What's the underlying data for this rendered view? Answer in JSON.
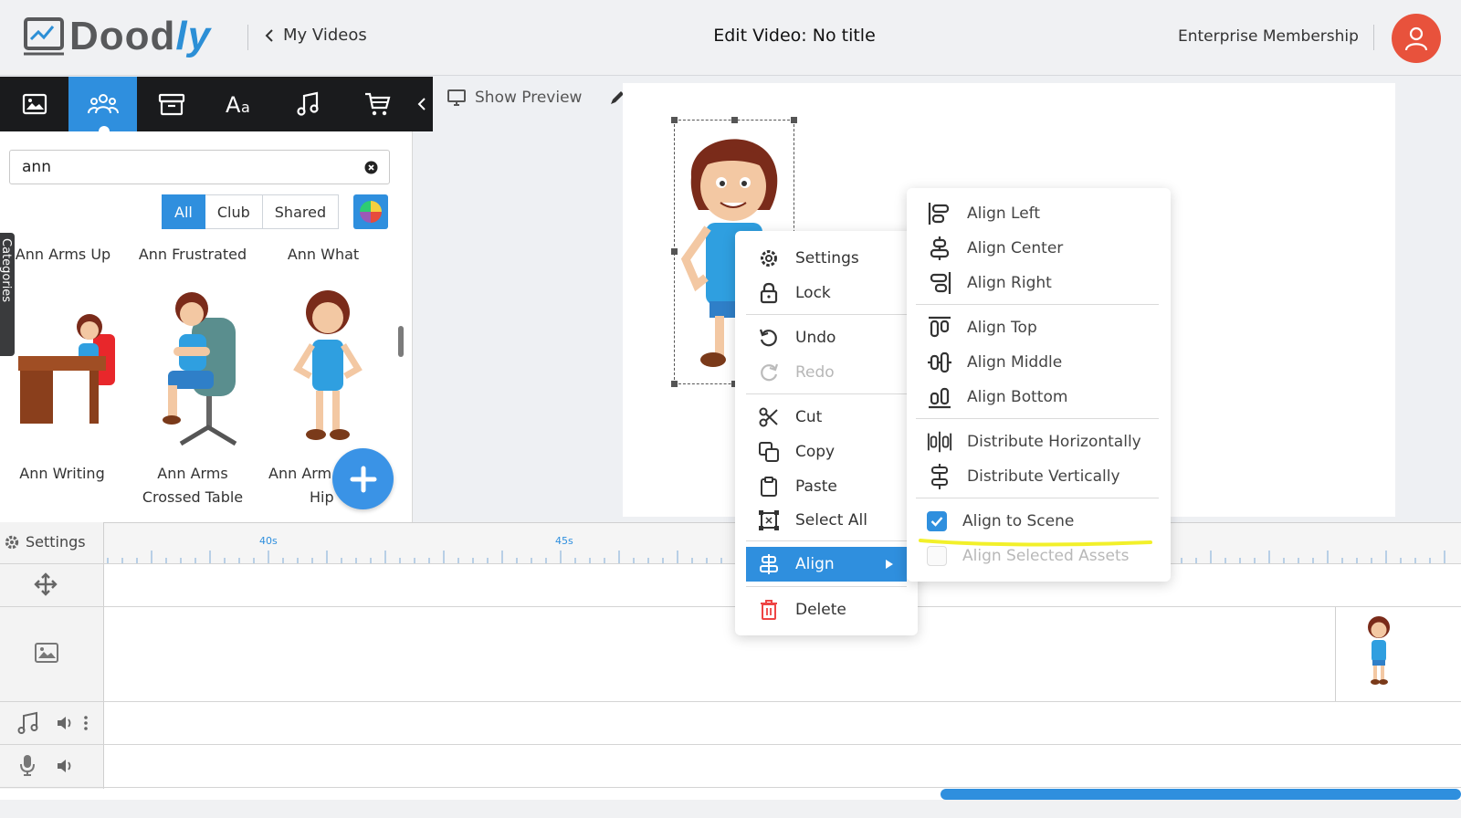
{
  "app": {
    "logo_text_main": "Dood",
    "logo_text_accent": "ly",
    "back_label": "My Videos",
    "title": "Edit Video: No title",
    "membership": "Enterprise Membership"
  },
  "colors": {
    "accent": "#2f8fde",
    "tabbar_bg": "#1a1b1d",
    "avatar_bg": "#e8523c",
    "delete_icon": "#e44",
    "highlighter": "#f2f02a"
  },
  "library": {
    "tabs": [
      {
        "name": "image-icon",
        "active": false
      },
      {
        "name": "characters-icon",
        "active": true
      },
      {
        "name": "props-icon",
        "active": false
      },
      {
        "name": "text-icon",
        "active": false
      },
      {
        "name": "music-icon",
        "active": false
      },
      {
        "name": "cart-icon",
        "active": false
      }
    ],
    "search_value": "ann",
    "filters": [
      "All",
      "Club",
      "Shared"
    ],
    "active_filter": "All",
    "categories_label": "Categories",
    "assets_row1": [
      "Ann Arms Up",
      "Ann Frustrated",
      "Ann What"
    ],
    "assets_row2": [
      {
        "line1": "Ann Writing",
        "line2": ""
      },
      {
        "line1": "Ann Arms",
        "line2": "Crossed Table"
      },
      {
        "line1": "Ann Arm",
        "line2": "Hip"
      }
    ]
  },
  "canvas": {
    "preview_label": "Show Preview",
    "tools": [
      "pencil-icon",
      "gear-icon",
      "flip-icon",
      "bring-forward-icon",
      "send-backward-icon",
      "trash-icon"
    ]
  },
  "context_menu": {
    "items": [
      {
        "label": "Settings",
        "icon": "gear-icon"
      },
      {
        "label": "Lock",
        "icon": "lock-icon"
      },
      {
        "label": "Undo",
        "icon": "undo-icon"
      },
      {
        "label": "Redo",
        "icon": "redo-icon",
        "disabled": true
      },
      {
        "label": "Cut",
        "icon": "scissors-icon"
      },
      {
        "label": "Copy",
        "icon": "copy-icon"
      },
      {
        "label": "Paste",
        "icon": "clipboard-icon"
      },
      {
        "label": "Select All",
        "icon": "select-all-icon"
      },
      {
        "label": "Align",
        "icon": "align-icon",
        "highlighted": true
      },
      {
        "label": "Delete",
        "icon": "trash-icon"
      }
    ]
  },
  "align_menu": {
    "items": [
      {
        "label": "Align Left",
        "icon": "align-left-icon"
      },
      {
        "label": "Align Center",
        "icon": "align-center-icon"
      },
      {
        "label": "Align Right",
        "icon": "align-right-icon"
      },
      {
        "label": "Align Top",
        "icon": "align-top-icon"
      },
      {
        "label": "Align Middle",
        "icon": "align-middle-icon"
      },
      {
        "label": "Align Bottom",
        "icon": "align-bottom-icon"
      },
      {
        "label": "Distribute Horizontally",
        "icon": "distribute-horizontal-icon"
      },
      {
        "label": "Distribute Vertically",
        "icon": "distribute-vertical-icon"
      }
    ],
    "align_to_scene": {
      "label": "Align to Scene",
      "checked": true
    },
    "align_selected_assets": {
      "label": "Align Selected Assets",
      "checked": false,
      "disabled": true
    }
  },
  "timeline": {
    "settings_label": "Settings",
    "tick_labels": [
      "40s",
      "45s"
    ]
  }
}
